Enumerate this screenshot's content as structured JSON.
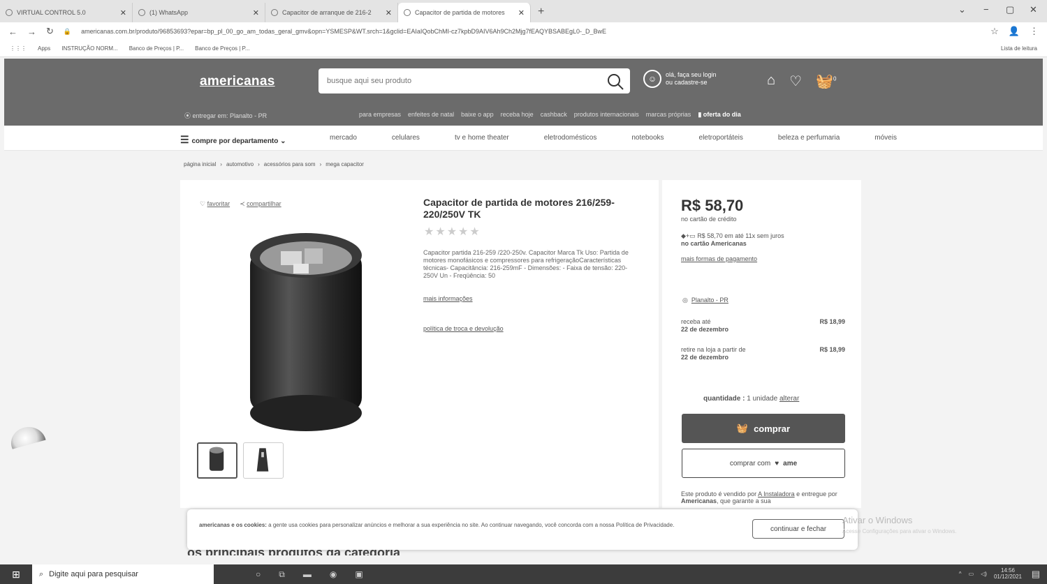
{
  "browser": {
    "tabs": [
      {
        "label": "VIRTUAL CONTROL 5.0",
        "active": false
      },
      {
        "label": "(1) WhatsApp",
        "active": false
      },
      {
        "label": "Capacitor de arranque de 216-2",
        "active": false
      },
      {
        "label": "Capacitor de partida de motores",
        "active": true
      }
    ],
    "url": "americanas.com.br/produto/96853693?epar=bp_pl_00_go_am_todas_geral_gmv&opn=YSMESP&WT.srch=1&gclid=EAIaIQobChMI-cz7kpbD9AIV6Ah9Ch2Mjg7fEAQYBSABEgL0-_D_BwE",
    "bookmarks": [
      "Apps",
      "INSTRUÇÃO NORM...",
      "Banco de Preços | P...",
      "Banco de Preços | P..."
    ],
    "reading_list": "Lista de leitura"
  },
  "header": {
    "logo": "americanas",
    "search_placeholder": "busque aqui seu produto",
    "login_line1": "olá, faça seu login",
    "login_line2": "ou cadastre-se",
    "cart_count": "0",
    "location": "entregar em: Planalto - PR",
    "links": [
      "para empresas",
      "enfeites de natal",
      "baixe o app",
      "receba hoje",
      "cashback",
      "produtos internacionais",
      "marcas próprias"
    ],
    "deal": "oferta do dia"
  },
  "nav": {
    "dept": "compre por departamento",
    "items": [
      "mercado",
      "celulares",
      "tv e home theater",
      "eletrodomésticos",
      "notebooks",
      "eletroportáteis",
      "beleza e perfumaria",
      "móveis"
    ]
  },
  "breadcrumb": [
    "página inicial",
    "automotivo",
    "acessórios para som",
    "mega capacitor"
  ],
  "product": {
    "favorite": "favoritar",
    "share": "compartilhar",
    "title": "Capacitor de partida de motores 216/259-220/250V TK",
    "stars": "★★★★★",
    "description": "Capacitor partida 216-259 /220-250v. Capacitor Marca Tk Uso: Partida de motores monofásicos e compressores para refrigeraçãoCaracterísticas técnicas- Capacitância: 216-259mF - Dimensões: - Faixa de tensão: 220-250V Un - Freqüência: 50",
    "more_info": "mais informações",
    "policy": "política de troca e devolução"
  },
  "buy": {
    "price": "R$ 58,70",
    "price_sub": "no cartão de crédito",
    "installment": "R$ 58,70 em até 11x sem juros",
    "installment_card": "no cartão Americanas",
    "payment_ways": "mais formas de pagamento",
    "location": "Planalto - PR",
    "shipping": [
      {
        "label": "receba até",
        "date": "22 de dezembro",
        "price": "R$ 18,99"
      },
      {
        "label": "retire na loja a partir de",
        "date": "22 de dezembro",
        "price": "R$ 18,99"
      }
    ],
    "quantity_label": "quantidade :",
    "quantity_value": "1 unidade",
    "quantity_change": "alterar",
    "buy_button": "comprar",
    "buy_ame_prefix": "comprar com",
    "buy_ame_brand": "ame",
    "seller_text": "Este produto é vendido por",
    "seller_name": "A Instaladora",
    "seller_text2": "e entregue por",
    "seller_deliver": "Americanas",
    "seller_text3": ", que garante a sua"
  },
  "cookie": {
    "bold": "americanas e os cookies:",
    "text": " a gente usa cookies para personalizar anúncios e melhorar a sua experiência no site. Ao continuar navegando, você concorda com a nossa Política de Privacidade.",
    "button": "continuar e fechar"
  },
  "watermark": {
    "line1": "Ativar o Windows",
    "line2": "Acesse Configurações para ativar o Windows."
  },
  "section_title": "os principais produtos da categoria",
  "taskbar": {
    "search": "Digite aqui para pesquisar",
    "time": "14:56",
    "date": "01/12/2021"
  }
}
